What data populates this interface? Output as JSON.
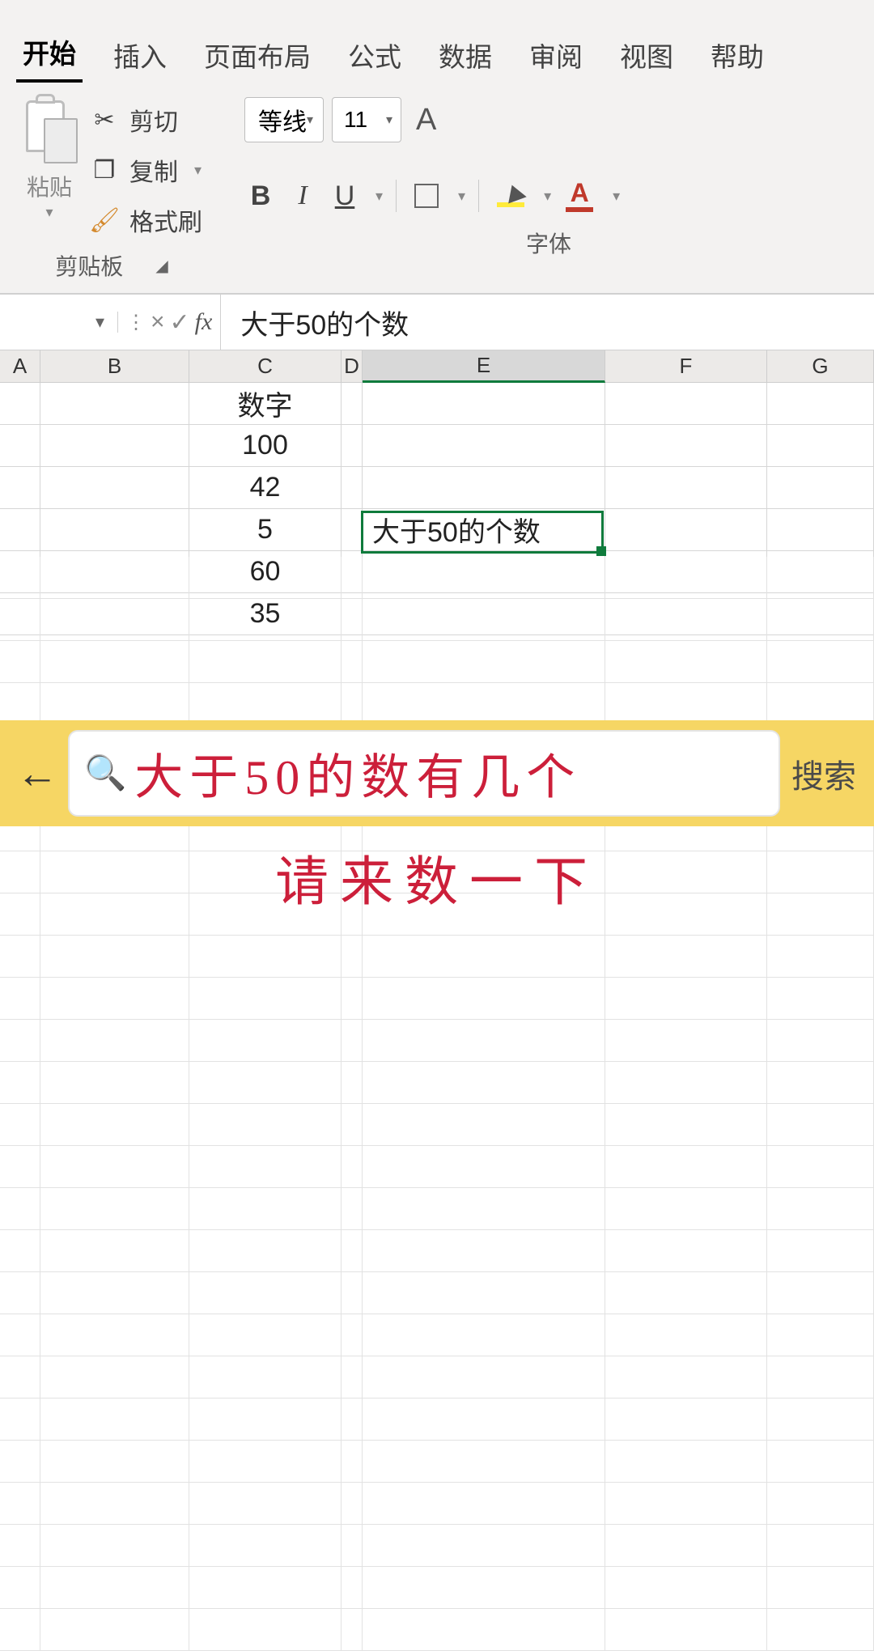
{
  "tabs": {
    "home": "开始",
    "insert": "插入",
    "layout": "页面布局",
    "formula": "公式",
    "data": "数据",
    "review": "审阅",
    "view": "视图",
    "help": "帮助"
  },
  "clipboard": {
    "paste_label": "粘贴",
    "cut_label": "剪切",
    "copy_label": "复制",
    "format_painter_label": "格式刷",
    "group_label": "剪贴板"
  },
  "font": {
    "font_name": "等线",
    "font_size": "11",
    "group_label": "字体",
    "bold": "B",
    "italic": "I",
    "underline": "U",
    "scale_char": "A",
    "font_color_char": "A"
  },
  "formula_bar": {
    "cancel": "×",
    "confirm": "✓",
    "fx": "fx",
    "content": "大于50的个数"
  },
  "columns": [
    "A",
    "B",
    "C",
    "D",
    "E",
    "F",
    "G"
  ],
  "sheet": {
    "c_header": "数字",
    "c_values": [
      "100",
      "42",
      "5",
      "60",
      "35"
    ],
    "e4": "大于50的个数"
  },
  "overlay": {
    "search_text": "大于50的数有几个",
    "search_button": "搜索",
    "caption": "请来数一下"
  }
}
